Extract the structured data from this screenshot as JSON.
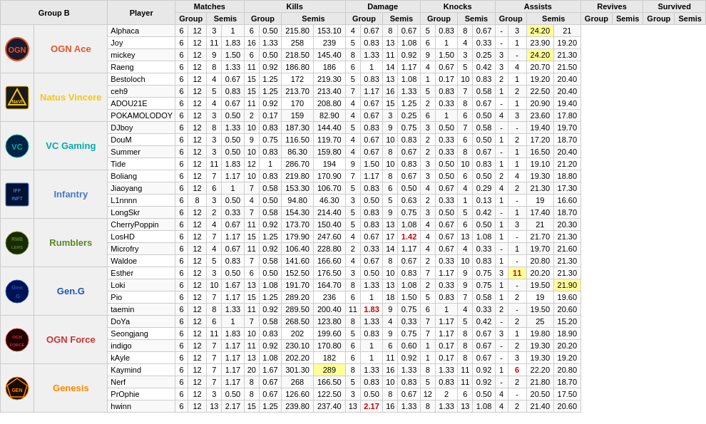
{
  "header": {
    "group_b": "Group B",
    "player": "Player",
    "matches": "Matches",
    "kills": "Kills",
    "damage": "Damage",
    "knocks": "Knocks",
    "assists": "Assists",
    "revives": "Revives",
    "survived": "Survived",
    "group": "Group",
    "semis": "Semis"
  },
  "teams": [
    {
      "name": "OGN Ace",
      "logo": "ogn-ace",
      "color": "#e8522a",
      "players": [
        {
          "name": "Alphaca",
          "mg": 6,
          "ms": 12,
          "kg": 3,
          "ks": 1.0,
          "ksg": 6,
          "kss": 0.5,
          "dg": 215.8,
          "ds": 153.1,
          "nog": 4,
          "nos": 0.67,
          "nsg": 8,
          "nss": 0.67,
          "ag": 5,
          "as_": 0.83,
          "asg": 8,
          "ass_": 0.67,
          "rg": "-",
          "rs": 3,
          "survg": 24.2,
          "survs": 21.0
        },
        {
          "name": "Joy",
          "mg": 6,
          "ms": 12,
          "kg": 11,
          "ks": 1.83,
          "ksg": 16,
          "kss": 1.33,
          "dg": 258.0,
          "ds": 239.0,
          "nog": 5,
          "nos": 0.83,
          "nsg": 13,
          "nss": 1.08,
          "ag": 6,
          "as_": 1.0,
          "asg": 4,
          "ass_": 0.33,
          "rg": "-",
          "rs": 1,
          "survg": 23.9,
          "survs": 19.2
        },
        {
          "name": "mickey",
          "mg": 6,
          "ms": 12,
          "kg": 9,
          "ks": 1.5,
          "ksg": 6,
          "kss": 0.5,
          "dg": 218.5,
          "ds": 145.4,
          "nog": 8,
          "nos": 1.33,
          "nsg": 11,
          "nss": 0.92,
          "ag": 9,
          "as_": 1.5,
          "asg": 3,
          "ass_": 0.25,
          "rg": 3,
          "rs": "-",
          "survg": 24.2,
          "survs": 21.3
        },
        {
          "name": "Raeng",
          "mg": 6,
          "ms": 12,
          "kg": 8,
          "ks": 1.33,
          "ksg": 11,
          "kss": 0.92,
          "dg": 186.8,
          "ds": 186.0,
          "nog": 6,
          "nos": 1.0,
          "nsg": 14,
          "nss": 1.17,
          "ag": 4,
          "as_": 0.67,
          "asg": 5,
          "ass_": 0.42,
          "rg": 3,
          "rs": 4,
          "survg": 20.7,
          "survs": 21.5
        }
      ]
    },
    {
      "name": "Natus Vincere",
      "logo": "navi",
      "color": "#f5c518",
      "players": [
        {
          "name": "Bestoloch",
          "mg": 6,
          "ms": 12,
          "kg": 4,
          "ks": 0.67,
          "ksg": 15,
          "kss": 1.25,
          "dg": 172.0,
          "ds": 219.3,
          "nog": 5,
          "nos": 0.83,
          "nsg": 13,
          "nss": 1.08,
          "ag": 1,
          "as_": 0.17,
          "asg": 10,
          "ass_": 0.83,
          "rg": 2,
          "rs": 1,
          "survg": 19.2,
          "survs": 20.4
        },
        {
          "name": "ceh9",
          "mg": 6,
          "ms": 12,
          "kg": 5,
          "ks": 0.83,
          "ksg": 15,
          "kss": 1.25,
          "dg": 213.7,
          "ds": 213.4,
          "nog": 7,
          "nos": 1.17,
          "nsg": 16,
          "nss": 1.33,
          "ag": 5,
          "as_": 0.83,
          "asg": 7,
          "ass_": 0.58,
          "rg": 1,
          "rs": 2,
          "survg": 22.5,
          "survs": 20.4
        },
        {
          "name": "ADOU21E",
          "mg": 6,
          "ms": 12,
          "kg": 4,
          "ks": 0.67,
          "ksg": 11,
          "kss": 0.92,
          "dg": 170.0,
          "ds": 208.8,
          "nog": 4,
          "nos": 0.67,
          "nsg": 15,
          "nss": 1.25,
          "ag": 2,
          "as_": 0.33,
          "asg": 8,
          "ass_": 0.67,
          "rg": "-",
          "rs": 1,
          "survg": 20.9,
          "survs": 19.4
        },
        {
          "name": "POKAMOLODOY",
          "mg": 6,
          "ms": 12,
          "kg": 3,
          "ks": 0.5,
          "ksg": 2,
          "kss": 0.17,
          "dg": 159.0,
          "ds": 82.9,
          "nog": 4,
          "nos": 0.67,
          "nsg": 3,
          "nss": 0.25,
          "ag": 6,
          "as_": 1.0,
          "asg": 6,
          "ass_": 0.5,
          "rg": 4,
          "rs": 3,
          "survg": 23.6,
          "survs": 17.8
        }
      ]
    },
    {
      "name": "VC Gaming",
      "logo": "vc",
      "color": "#00aaaa",
      "players": [
        {
          "name": "DJboy",
          "mg": 6,
          "ms": 12,
          "kg": 8,
          "ks": 1.33,
          "ksg": 10,
          "kss": 0.83,
          "dg": 187.3,
          "ds": 144.4,
          "nog": 5,
          "nos": 0.83,
          "nsg": 9,
          "nss": 0.75,
          "ag": 3,
          "as_": 0.5,
          "asg": 7,
          "ass_": 0.58,
          "rg": "-",
          "rs": "-",
          "survg": 19.4,
          "survs": 19.7
        },
        {
          "name": "DouM",
          "mg": 6,
          "ms": 12,
          "kg": 3,
          "ks": 0.5,
          "ksg": 9,
          "kss": 0.75,
          "dg": 116.5,
          "ds": 119.7,
          "nog": 4,
          "nos": 0.67,
          "nsg": 10,
          "nss": 0.83,
          "ag": 2,
          "as_": 0.33,
          "asg": 6,
          "ass_": 0.5,
          "rg": 1,
          "rs": 2,
          "survg": 17.2,
          "survs": 18.7
        },
        {
          "name": "Summer",
          "mg": 6,
          "ms": 12,
          "kg": 3,
          "ks": 0.5,
          "ksg": 10,
          "kss": 0.83,
          "dg": 86.3,
          "ds": 159.8,
          "nog": 4,
          "nos": 0.67,
          "nsg": 8,
          "nss": 0.67,
          "ag": 2,
          "as_": 0.33,
          "asg": 8,
          "ass_": 0.67,
          "rg": "-",
          "rs": 1,
          "survg": 16.5,
          "survs": 20.4
        },
        {
          "name": "Tide",
          "mg": 6,
          "ms": 12,
          "kg": 11,
          "ks": 1.83,
          "ksg": 12,
          "kss": 1.0,
          "dg": 286.7,
          "ds": 194.0,
          "nog": 9,
          "nos": 1.5,
          "nsg": 10,
          "nss": 0.83,
          "ag": 3,
          "as_": 0.5,
          "asg": 10,
          "ass_": 0.83,
          "rg": 1,
          "rs": 1,
          "survg": 19.1,
          "survs": 21.2
        }
      ]
    },
    {
      "name": "Infantry",
      "logo": "infantry",
      "color": "#4477cc",
      "players": [
        {
          "name": "Boliang",
          "mg": 6,
          "ms": 12,
          "kg": 7,
          "ks": 1.17,
          "ksg": 10,
          "kss": 0.83,
          "dg": 219.8,
          "ds": 170.9,
          "nog": 7,
          "nos": 1.17,
          "nsg": 8,
          "nss": 0.67,
          "ag": 3,
          "as_": 0.5,
          "asg": 6,
          "ass_": 0.5,
          "rg": 2,
          "rs": 4,
          "survg": 19.3,
          "survs": 18.8
        },
        {
          "name": "Jiaoyang",
          "mg": 6,
          "ms": 12,
          "kg": 6,
          "ks": 1.0,
          "ksg": 7,
          "kss": 0.58,
          "dg": 153.3,
          "ds": 106.7,
          "nog": 5,
          "nos": 0.83,
          "nsg": 6,
          "nss": 0.5,
          "ag": 4,
          "as_": 0.67,
          "asg": 4,
          "ass_": 0.29,
          "rg": 4,
          "rs": 2,
          "survg": 21.3,
          "survs": 17.3
        },
        {
          "name": "L1nnnn",
          "mg": 6,
          "ms": 8,
          "kg": 3,
          "ks": 0.5,
          "ksg": 4,
          "kss": 0.5,
          "dg": 94.8,
          "ds": 46.3,
          "nog": 3,
          "nos": 0.5,
          "nsg": 5,
          "nss": 0.63,
          "ag": 2,
          "as_": 0.33,
          "asg": 1,
          "ass_": 0.13,
          "rg": 1,
          "rs": "-",
          "survg": 19.0,
          "survs": 16.6
        },
        {
          "name": "LongSkr",
          "mg": 6,
          "ms": 12,
          "kg": 2,
          "ks": 0.33,
          "ksg": 7,
          "kss": 0.58,
          "dg": 154.3,
          "ds": 214.4,
          "nog": 5,
          "nos": 0.83,
          "nsg": 9,
          "nss": 0.75,
          "ag": 3,
          "as_": 0.5,
          "asg": 5,
          "ass_": 0.42,
          "rg": "-",
          "rs": 1,
          "survg": 17.4,
          "survs": 18.7
        }
      ]
    },
    {
      "name": "Rumblers",
      "logo": "rumblers",
      "color": "#558822",
      "players": [
        {
          "name": "CherryPoppin",
          "mg": 6,
          "ms": 12,
          "kg": 4,
          "ks": 0.67,
          "ksg": 11,
          "kss": 0.92,
          "dg": 173.7,
          "ds": 150.4,
          "nog": 5,
          "nos": 0.83,
          "nsg": 13,
          "nss": 1.08,
          "ag": 4,
          "as_": 0.67,
          "asg": 6,
          "ass_": 0.5,
          "rg": 1,
          "rs": 3,
          "survg": 21.0,
          "survs": 20.3
        },
        {
          "name": "LosHD",
          "mg": 6,
          "ms": 12,
          "kg": 7,
          "ks": 1.17,
          "ksg": 15,
          "kss": 1.25,
          "dg": 179.9,
          "ds": 247.6,
          "nog": 4,
          "nos": 0.67,
          "nsg": 17,
          "nss": 1.42,
          "ag": 4,
          "as_": 0.67,
          "asg": 13,
          "ass_": 1.08,
          "rg": 1,
          "rs": "-",
          "survg": 21.7,
          "survs": 21.3
        },
        {
          "name": "Microfry",
          "mg": 6,
          "ms": 12,
          "kg": 4,
          "ks": 0.67,
          "ksg": 11,
          "kss": 0.92,
          "dg": 106.4,
          "ds": 228.8,
          "nog": 2,
          "nos": 0.33,
          "nsg": 14,
          "nss": 1.17,
          "ag": 4,
          "as_": 0.67,
          "asg": 4,
          "ass_": 0.33,
          "rg": "-",
          "rs": 1,
          "survg": 19.7,
          "survs": 21.6
        },
        {
          "name": "Waldoe",
          "mg": 6,
          "ms": 12,
          "kg": 5,
          "ks": 0.83,
          "ksg": 7,
          "kss": 0.58,
          "dg": 141.6,
          "ds": 166.6,
          "nog": 4,
          "nos": 0.67,
          "nsg": 8,
          "nss": 0.67,
          "ag": 2,
          "as_": 0.33,
          "asg": 10,
          "ass_": 0.83,
          "rg": 1,
          "rs": "-",
          "survg": 20.8,
          "survs": 21.3
        }
      ]
    },
    {
      "name": "Gen.G",
      "logo": "geng",
      "color": "#2255aa",
      "players": [
        {
          "name": "Esther",
          "mg": 6,
          "ms": 12,
          "kg": 3,
          "ks": 0.5,
          "ksg": 6,
          "kss": 0.5,
          "dg": 152.5,
          "ds": 176.5,
          "nog": 3,
          "nos": 0.5,
          "nsg": 10,
          "nss": 0.83,
          "ag": 7,
          "as_": 1.17,
          "asg": 9,
          "ass_": 0.75,
          "rg": 3,
          "rs": 11,
          "survg": 20.2,
          "survs": 21.3
        },
        {
          "name": "Loki",
          "mg": 6,
          "ms": 12,
          "kg": 10,
          "ks": 1.67,
          "ksg": 13,
          "kss": 1.08,
          "dg": 191.7,
          "ds": 164.7,
          "nog": 8,
          "nos": 1.33,
          "nsg": 13,
          "nss": 1.08,
          "ag": 2,
          "as_": 0.33,
          "asg": 9,
          "ass_": 0.75,
          "rg": 1,
          "rs": "-",
          "survg": 19.5,
          "survs": 21.9
        },
        {
          "name": "Pio",
          "mg": 6,
          "ms": 12,
          "kg": 7,
          "ks": 1.17,
          "ksg": 15,
          "kss": 1.25,
          "dg": 289.2,
          "ds": 236.0,
          "nog": 6,
          "nos": 1.0,
          "nsg": 18,
          "nss": 1.5,
          "ag": 5,
          "as_": 0.83,
          "asg": 7,
          "ass_": 0.58,
          "rg": 1,
          "rs": 2,
          "survg": 19.0,
          "survs": 19.6
        },
        {
          "name": "taemin",
          "mg": 6,
          "ms": 12,
          "kg": 8,
          "ks": 1.33,
          "ksg": 11,
          "kss": 0.92,
          "dg": 289.5,
          "ds": 200.4,
          "nog": 11,
          "nos": 1.83,
          "nsg": 9,
          "nss": 0.75,
          "ag": 6,
          "as_": 1.0,
          "asg": 4,
          "ass_": 0.33,
          "rg": 2,
          "rs": "-",
          "survg": 19.5,
          "survs": 20.6
        }
      ]
    },
    {
      "name": "OGN Force",
      "logo": "ognforce",
      "color": "#cc3333",
      "players": [
        {
          "name": "DoYa",
          "mg": 6,
          "ms": 12,
          "kg": 6,
          "ks": 1.0,
          "ksg": 7,
          "kss": 0.58,
          "dg": 268.5,
          "ds": 123.8,
          "nog": 8,
          "nos": 1.33,
          "nsg": 4,
          "nss": 0.33,
          "ag": 7,
          "as_": 1.17,
          "asg": 5,
          "ass_": 0.42,
          "rg": "-",
          "rs": 2,
          "survg": 25.0,
          "survs": 15.2
        },
        {
          "name": "Seongjang",
          "mg": 6,
          "ms": 12,
          "kg": 11,
          "ks": 1.83,
          "ksg": 10,
          "kss": 0.83,
          "dg": 202.0,
          "ds": 199.6,
          "nog": 5,
          "nos": 0.83,
          "nsg": 9,
          "nss": 0.75,
          "ag": 7,
          "as_": 1.17,
          "asg": 8,
          "ass_": 0.67,
          "rg": 3,
          "rs": 1,
          "survg": 19.8,
          "survs": 18.9
        },
        {
          "name": "indigo",
          "mg": 6,
          "ms": 12,
          "kg": 7,
          "ks": 1.17,
          "ksg": 11,
          "kss": 0.92,
          "dg": 230.1,
          "ds": 170.8,
          "nog": 6,
          "nos": 1.0,
          "nsg": 6,
          "nss": 0.6,
          "ag": 1,
          "as_": 0.17,
          "asg": 8,
          "ass_": 0.67,
          "rg": "-",
          "rs": 2,
          "survg": 19.3,
          "survs": 20.2
        },
        {
          "name": "kAyle",
          "mg": 6,
          "ms": 12,
          "kg": 7,
          "ks": 1.17,
          "ksg": 13,
          "kss": 1.08,
          "dg": 202.2,
          "ds": 182.0,
          "nog": 6,
          "nos": 1.0,
          "nsg": 11,
          "nss": 0.92,
          "ag": 1,
          "as_": 0.17,
          "asg": 8,
          "ass_": 0.67,
          "rg": "-",
          "rs": 3,
          "survg": 19.3,
          "survs": 19.2
        }
      ]
    },
    {
      "name": "Genesis",
      "logo": "genesis",
      "color": "#ff8800",
      "players": [
        {
          "name": "Kaymind",
          "mg": 6,
          "ms": 12,
          "kg": 7,
          "ks": 1.17,
          "ksg": 20,
          "kss": 1.67,
          "dg": 301.3,
          "ds": 289.0,
          "nog": 8,
          "nos": 1.33,
          "nsg": 16,
          "nss": 1.33,
          "ag": 8,
          "as_": 1.33,
          "asg": 11,
          "ass_": 0.92,
          "rg": 1,
          "rs": 6,
          "survg": 22.2,
          "survs": 20.8
        },
        {
          "name": "Nerf",
          "mg": 6,
          "ms": 12,
          "kg": 7,
          "ks": 1.17,
          "ksg": 8,
          "kss": 0.67,
          "dg": 268.0,
          "ds": 166.5,
          "nog": 5,
          "nos": 0.83,
          "nsg": 10,
          "nss": 0.83,
          "ag": 5,
          "as_": 0.83,
          "asg": 11,
          "ass_": 0.92,
          "rg": "-",
          "rs": 2,
          "survg": 21.8,
          "survs": 18.7
        },
        {
          "name": "PrOphie",
          "mg": 6,
          "ms": 12,
          "kg": 3,
          "ks": 0.5,
          "ksg": 8,
          "kss": 0.67,
          "dg": 126.6,
          "ds": 122.5,
          "nog": 3,
          "nos": 0.5,
          "nsg": 8,
          "nss": 0.67,
          "ag": 12,
          "as_": 2.0,
          "asg": 6,
          "ass_": 0.5,
          "rg": 4,
          "rs": "-",
          "survg": 20.5,
          "survs": 17.5
        },
        {
          "name": "hwinn",
          "mg": 6,
          "ms": 12,
          "kg": 13,
          "ks": 2.17,
          "ksg": 15,
          "kss": 1.25,
          "dg": 239.8,
          "ds": 237.4,
          "nog": 13,
          "nos": 2.17,
          "nsg": 16,
          "nss": 1.33,
          "ag": 8,
          "as_": 1.33,
          "asg": 13,
          "ass_": 1.08,
          "rg": 4,
          "rs": 2,
          "survg": 21.4,
          "survs": 20.6
        }
      ]
    }
  ]
}
